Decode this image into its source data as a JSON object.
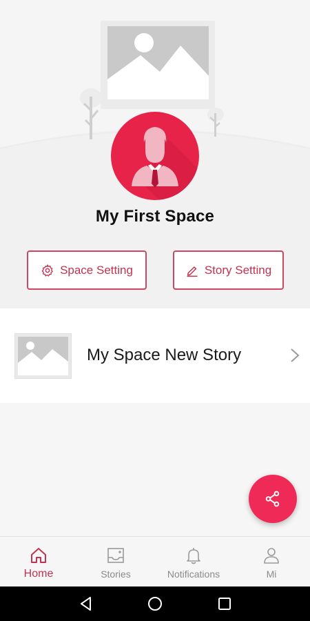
{
  "space": {
    "title": "My First Space",
    "space_setting_label": "Space Setting",
    "story_setting_label": "Story Setting"
  },
  "stories": [
    {
      "title": "My Space New Story"
    }
  ],
  "bottom_nav": {
    "items": [
      {
        "label": "Home",
        "icon": "home-icon",
        "active": true
      },
      {
        "label": "Stories",
        "icon": "stories-icon",
        "active": false
      },
      {
        "label": "Notifications",
        "icon": "bell-icon",
        "active": false
      },
      {
        "label": "Mi",
        "icon": "user-icon",
        "active": false
      }
    ]
  },
  "fab": {
    "icon": "share-icon"
  },
  "system_nav": {
    "buttons": [
      "back-icon",
      "home-circle-icon",
      "recents-icon"
    ]
  },
  "colors": {
    "accent": "#e8234a",
    "accent_text": "#c2334f",
    "background": "#f6f6f6"
  }
}
